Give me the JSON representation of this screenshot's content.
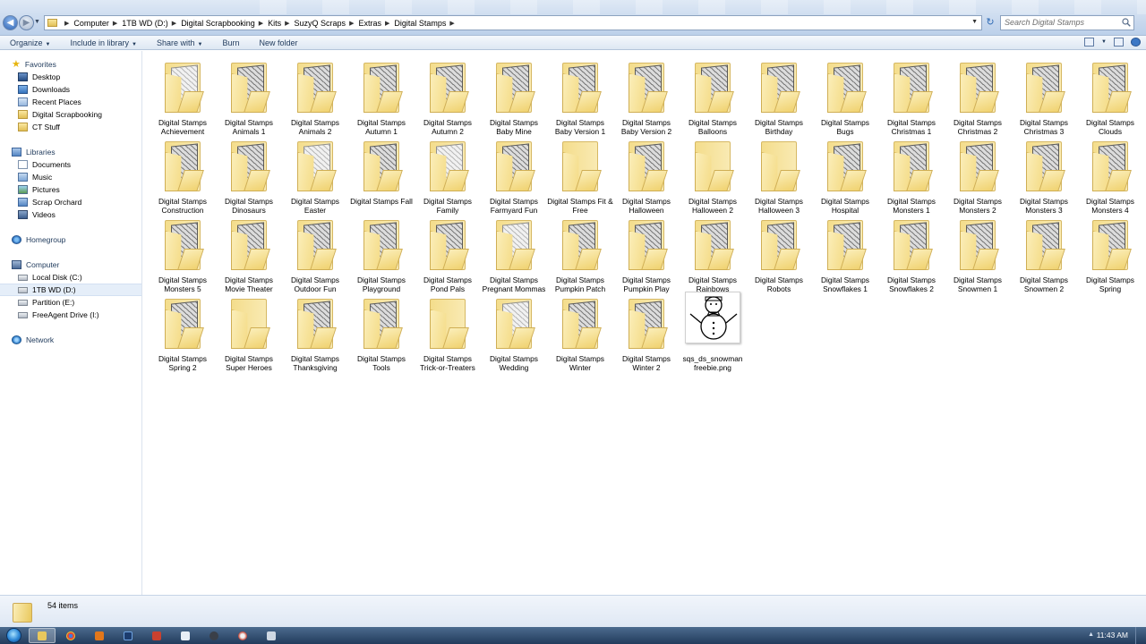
{
  "address": {
    "crumbs": [
      "Computer",
      "1TB WD (D:)",
      "Digital Scrapbooking",
      "Kits",
      "SuzyQ Scraps",
      "Extras",
      "Digital Stamps"
    ]
  },
  "search": {
    "placeholder": "Search Digital Stamps"
  },
  "toolbar": {
    "organize": "Organize",
    "include_in_library": "Include in library",
    "share_with": "Share with",
    "burn": "Burn",
    "new_folder": "New folder"
  },
  "nav": {
    "favorites": "Favorites",
    "favorites_items": [
      "Desktop",
      "Downloads",
      "Recent Places",
      "Digital Scrapbooking",
      "CT Stuff"
    ],
    "libraries": "Libraries",
    "libraries_items": [
      "Documents",
      "Music",
      "Pictures",
      "Scrap Orchard",
      "Videos"
    ],
    "homegroup": "Homegroup",
    "computer": "Computer",
    "computer_items": [
      "Local Disk (C:)",
      "1TB WD (D:)",
      "Partition (E:)",
      "FreeAgent Drive (I:)"
    ],
    "network": "Network"
  },
  "files": [
    {
      "name": "Digital Stamps Achievement",
      "style": "light"
    },
    {
      "name": "Digital Stamps Animals 1",
      "style": "dark"
    },
    {
      "name": "Digital Stamps Animals 2",
      "style": "dark"
    },
    {
      "name": "Digital Stamps Autumn 1",
      "style": "dark"
    },
    {
      "name": "Digital Stamps Autumn 2",
      "style": "dark"
    },
    {
      "name": "Digital Stamps Baby Mine",
      "style": "dark"
    },
    {
      "name": "Digital Stamps Baby Version 1",
      "style": "dark"
    },
    {
      "name": "Digital Stamps Baby Version 2",
      "style": "dark"
    },
    {
      "name": "Digital Stamps Balloons",
      "style": "dark"
    },
    {
      "name": "Digital Stamps Birthday",
      "style": "dark"
    },
    {
      "name": "Digital Stamps Bugs",
      "style": "dark"
    },
    {
      "name": "Digital Stamps Christmas 1",
      "style": "dark"
    },
    {
      "name": "Digital Stamps Christmas 2",
      "style": "dark"
    },
    {
      "name": "Digital Stamps Christmas 3",
      "style": "dark"
    },
    {
      "name": "Digital Stamps Clouds",
      "style": "dark"
    },
    {
      "name": "Digital Stamps Construction",
      "style": "dark"
    },
    {
      "name": "Digital Stamps Dinosaurs",
      "style": "dark"
    },
    {
      "name": "Digital Stamps Easter",
      "style": "light"
    },
    {
      "name": "Digital Stamps Fall",
      "style": "dark"
    },
    {
      "name": "Digital Stamps Family",
      "style": "light"
    },
    {
      "name": "Digital Stamps Farmyard Fun",
      "style": "dark"
    },
    {
      "name": "Digital Stamps Fit & Free",
      "style": "none"
    },
    {
      "name": "Digital Stamps Halloween",
      "style": "dark"
    },
    {
      "name": "Digital Stamps Halloween 2",
      "style": "none"
    },
    {
      "name": "Digital Stamps Halloween 3",
      "style": "none"
    },
    {
      "name": "Digital Stamps Hospital",
      "style": "dark"
    },
    {
      "name": "Digital Stamps Monsters 1",
      "style": "dark"
    },
    {
      "name": "Digital Stamps Monsters 2",
      "style": "dark"
    },
    {
      "name": "Digital Stamps Monsters 3",
      "style": "dark"
    },
    {
      "name": "Digital Stamps Monsters 4",
      "style": "dark"
    },
    {
      "name": "Digital Stamps Monsters 5",
      "style": "dark"
    },
    {
      "name": "Digital Stamps Movie Theater",
      "style": "dark"
    },
    {
      "name": "Digital Stamps Outdoor Fun",
      "style": "dark"
    },
    {
      "name": "Digital Stamps Playground",
      "style": "dark"
    },
    {
      "name": "Digital Stamps Pond Pals",
      "style": "dark"
    },
    {
      "name": "Digital Stamps Pregnant Mommas",
      "style": "light"
    },
    {
      "name": "Digital Stamps Pumpkin Patch",
      "style": "dark"
    },
    {
      "name": "Digital Stamps Pumpkin Play",
      "style": "dark"
    },
    {
      "name": "Digital Stamps Rainbows",
      "style": "dark"
    },
    {
      "name": "Digital Stamps Robots",
      "style": "dark"
    },
    {
      "name": "Digital Stamps Snowflakes 1",
      "style": "dark"
    },
    {
      "name": "Digital Stamps Snowflakes 2",
      "style": "dark"
    },
    {
      "name": "Digital Stamps Snowmen 1",
      "style": "dark"
    },
    {
      "name": "Digital Stamps Snowmen 2",
      "style": "dark"
    },
    {
      "name": "Digital Stamps Spring",
      "style": "dark"
    },
    {
      "name": "Digital Stamps Spring 2",
      "style": "dark"
    },
    {
      "name": "Digital Stamps Super Heroes",
      "style": "none"
    },
    {
      "name": "Digital Stamps Thanksgiving",
      "style": "dark"
    },
    {
      "name": "Digital Stamps Tools",
      "style": "dark"
    },
    {
      "name": "Digital Stamps Trick-or-Treaters",
      "style": "none"
    },
    {
      "name": "Digital Stamps Wedding",
      "style": "light"
    },
    {
      "name": "Digital Stamps Winter",
      "style": "dark"
    },
    {
      "name": "Digital Stamps Winter 2",
      "style": "dark"
    },
    {
      "name": "sqs_ds_snowman freebie.png",
      "style": "png"
    }
  ],
  "status": {
    "item_count": "54 items"
  },
  "taskbar": {
    "clock": "11:43 AM"
  },
  "colors": {
    "folder": "#f2d678",
    "accent": "#1e395b",
    "taskbar": "#2b4669"
  }
}
